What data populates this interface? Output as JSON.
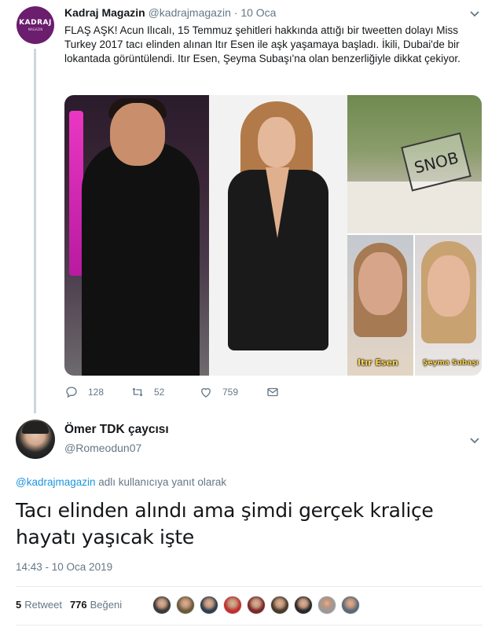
{
  "tweet": {
    "author_name": "Kadraj Magazin",
    "author_handle": "@kadrajmagazin",
    "separator": "·",
    "date": "10 Oca",
    "avatar_logo_text": "KADRAJ",
    "avatar_logo_sub": "MAGAZIN",
    "text": "FLAŞ AŞK! Acun Ilıcalı, 15 Temmuz şehitleri hakkında attığı bir tweetten dolayı Miss Turkey 2017 tacı elinden alınan Itır Esen ile aşk yaşamaya başladı. İkili, Dubai'de bir lokantada görüntülendi. Itır Esen, Şeyma Subaşı'na olan benzerliğiyle dikkat çekiyor.",
    "media": {
      "watermark_text": "SNOB",
      "caption_left": "Itır Esen",
      "caption_right": "Şeyma Subaşı"
    },
    "actions": {
      "reply_count": "128",
      "retweet_count": "52",
      "like_count": "759"
    }
  },
  "reply": {
    "author_name": "Ömer TDK çaycısı",
    "author_handle": "@Romeodun07",
    "replying_to_mention": "@kadrajmagazin",
    "replying_to_suffix": " adlı kullanıcıya yanıt olarak",
    "text": "Tacı elinden alındı ama şimdi gerçek kraliçe hayatı yaşıcak işte",
    "timestamp": "14:43 - 10 Oca 2019",
    "retweet_count": "5",
    "retweet_label": "Retweet",
    "like_count": "776",
    "like_label": "Beğeni",
    "liker_colors": [
      "#3b3b3b",
      "#6b5a3a",
      "#2f3f4f",
      "#c0302f",
      "#7a2a2a",
      "#4a3a2a",
      "#2a2a2a",
      "#9a9a9a",
      "#5a6a7a"
    ]
  },
  "colors": {
    "text_primary": "#14171a",
    "text_secondary": "#657786",
    "link": "#1b95e0",
    "divider": "#e6ecf0",
    "thread_line": "#ccd6dd"
  },
  "icons": [
    "reply-icon",
    "retweet-icon",
    "like-icon",
    "direct-message-icon",
    "chevron-down-icon"
  ]
}
